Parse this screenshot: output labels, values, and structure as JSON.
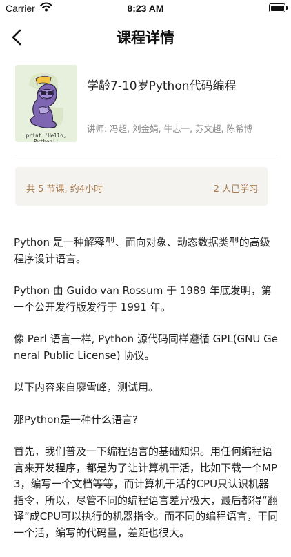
{
  "status_bar": {
    "carrier": "Carrier",
    "time": "8:23 AM"
  },
  "nav": {
    "title": "课程详情",
    "back_icon": "chevron-left-icon"
  },
  "course": {
    "title": "学龄7-10岁Python代码编程",
    "instructors": "讲师: 冯超, 刘金娟, 牛志一, 苏文超, 陈希博",
    "cover_caption": "print 'Hello, Python!'"
  },
  "stats": {
    "lessons": "共 5 节课, 约4小时",
    "learners": "2 人已学习"
  },
  "intro": {
    "paragraphs": [
      "Python 是一种解释型、面向对象、动态数据类型的高级程序设计语言。",
      "Python 由 Guido van Rossum 于 1989 年底发明，第一个公开发行版发行于 1991 年。",
      "像 Perl 语言一样, Python 源代码同样遵循 GPL(GNU General Public License) 协议。",
      "以下内容来自廖雪峰，测试用。",
      "那Python是一种什么语言?",
      "首先，我们普及一下编程语言的基础知识。用任何编程语言来开发程序，都是为了让计算机干活，比如下载一个MP3，编写一个文档等等，而计算机干活的CPU只认识机器指令，所以，尽管不同的编程语言差异极大，最后都得“翻译”成CPU可以执行的机器指令。而不同的编程语言，干同一个活，编写的代码量，差距也很大。"
    ]
  },
  "colors": {
    "accent": "#a87a4c",
    "stats_bg": "#f5f3ef",
    "muted": "#8a8a8a"
  }
}
